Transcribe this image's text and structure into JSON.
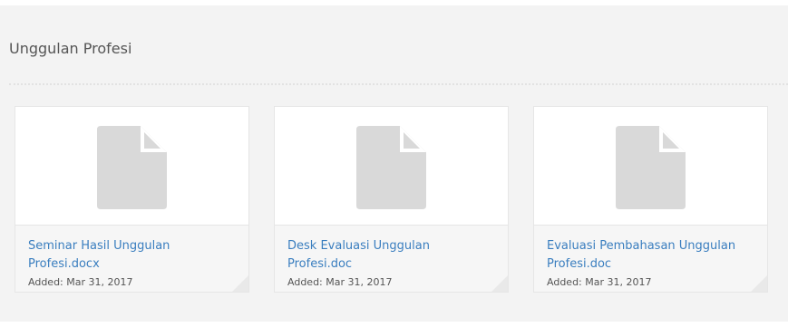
{
  "section": {
    "title": "Unggulan Profesi"
  },
  "files": [
    {
      "name": "Seminar Hasil Unggulan Profesi.docx",
      "added": "Added: Mar 31, 2017",
      "icon": "document-icon"
    },
    {
      "name": "Desk Evaluasi Unggulan Profesi.doc",
      "added": "Added: Mar 31, 2017",
      "icon": "document-icon"
    },
    {
      "name": "Evaluasi Pembahasan Unggulan Profesi.doc",
      "added": "Added: Mar 31, 2017",
      "icon": "document-icon"
    }
  ],
  "colors": {
    "link": "#3a7ebf",
    "panel_background": "#f3f3f3",
    "icon_fill": "#d9d9d9"
  }
}
